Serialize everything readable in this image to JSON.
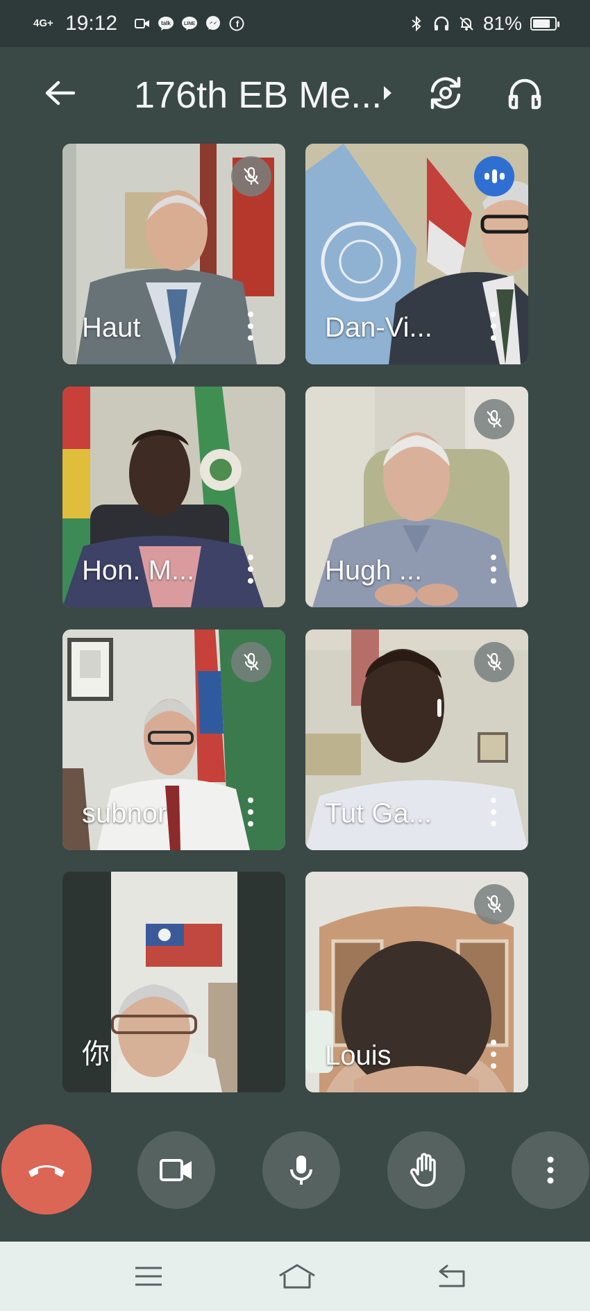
{
  "status_bar": {
    "network": "4G+",
    "time": "19:12",
    "battery": "81%",
    "battery_level": 0.81,
    "icons": [
      "video-camera-icon",
      "talk-app-icon",
      "line-app-icon",
      "messenger-icon",
      "facebook-icon",
      "bluetooth-icon",
      "headphones-icon",
      "do-not-disturb-icon",
      "battery-icon"
    ]
  },
  "header": {
    "title": "176th EB Me...",
    "icons": [
      "back-arrow-icon",
      "title-chevron-icon",
      "switch-camera-icon",
      "headphones-icon"
    ]
  },
  "participants": [
    {
      "name": "Haut",
      "muted": true,
      "speaking": false
    },
    {
      "name": "Dan-Vi...",
      "muted": false,
      "speaking": true
    },
    {
      "name": "Hon. M...",
      "muted": false,
      "speaking": false
    },
    {
      "name": "Hugh ...",
      "muted": true,
      "speaking": false
    },
    {
      "name": "subnor",
      "muted": true,
      "speaking": false
    },
    {
      "name": "Tut Ga...",
      "muted": true,
      "speaking": false
    },
    {
      "name": "你",
      "muted": false,
      "speaking": false
    },
    {
      "name": "Louis",
      "muted": true,
      "speaking": false
    }
  ],
  "controls": [
    "end-call-icon",
    "camera-icon",
    "microphone-icon",
    "raise-hand-icon",
    "more-options-icon"
  ],
  "nav": [
    "recent-apps-icon",
    "home-icon",
    "back-icon"
  ],
  "colors": {
    "background": "#3a4846",
    "status_bar": "#2e3a39",
    "end_call": "#dc6656",
    "control_button": "#55625f",
    "speaking_badge": "#2f6fd2",
    "nav_bar": "#e7efed"
  }
}
